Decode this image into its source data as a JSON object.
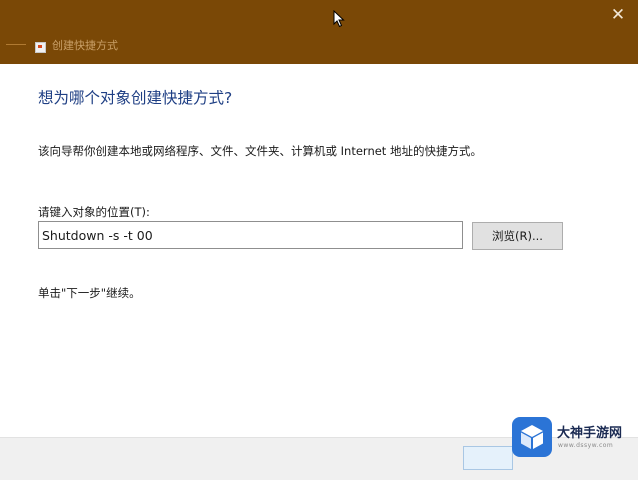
{
  "window": {
    "title": "创建快捷方式",
    "close_symbol": "✕",
    "icon": "shortcut-icon"
  },
  "wizard": {
    "heading": "想为哪个对象创建快捷方式?",
    "description": "该向导帮你创建本地或网络程序、文件、文件夹、计算机或 Internet 地址的快捷方式。",
    "location_label": "请键入对象的位置(T):",
    "location_value": "Shutdown -s -t 00",
    "browse_label": "浏览(R)...",
    "hint": "单击\"下一步\"继续。"
  },
  "watermark": {
    "name": "大神手游网",
    "url": "www.dssyw.com"
  },
  "colors": {
    "titlebar": "#7a4806",
    "heading": "#1f3f84",
    "footer": "#f0f0f0",
    "watermark_logo": "#2b74d6"
  }
}
